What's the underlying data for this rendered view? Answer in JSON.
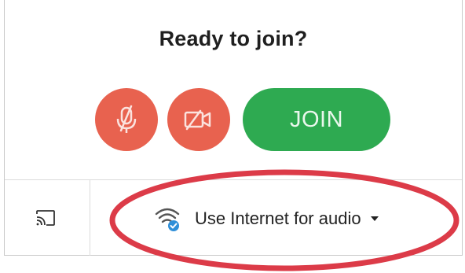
{
  "prompt": {
    "title": "Ready to join?"
  },
  "controls": {
    "mic_icon": "microphone-off-icon",
    "camera_icon": "camera-off-icon",
    "join_label": "JOIN"
  },
  "footer": {
    "cast_icon": "cast-icon",
    "audio_icon": "wifi-check-icon",
    "audio_label": "Use Internet for audio",
    "dropdown_icon": "caret-down-icon"
  },
  "colors": {
    "off_button": "#e8624f",
    "join_button": "#2eaa51",
    "annotation": "#dc3b48",
    "check_badge": "#2f8fd8"
  }
}
